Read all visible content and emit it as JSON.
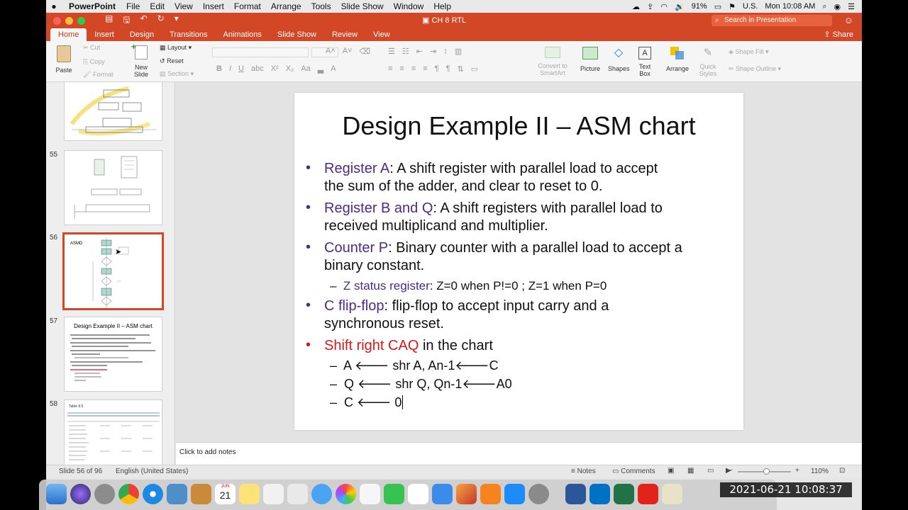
{
  "menubar": {
    "app": "PowerPoint",
    "items": [
      "File",
      "Edit",
      "View",
      "Insert",
      "Format",
      "Arrange",
      "Tools",
      "Slide Show",
      "Window",
      "Help"
    ],
    "battery": "91%",
    "input_source": "U.S.",
    "clock": "Mon 10:08 AM"
  },
  "titlebar": {
    "doc_title": "CH 8 RTL",
    "search_placeholder": "Search in Presentation"
  },
  "ribbon_tabs": {
    "items": [
      "Home",
      "Insert",
      "Design",
      "Transitions",
      "Animations",
      "Slide Show",
      "Review",
      "View"
    ],
    "active": "Home",
    "share": "Share"
  },
  "ribbon": {
    "paste": "Paste",
    "cut": "Cut",
    "copy": "Copy",
    "format": "Format",
    "new_slide_line1": "New",
    "new_slide_line2": "Slide",
    "layout": "Layout",
    "reset": "Reset",
    "section": "Section",
    "convert_line1": "Convert to",
    "convert_line2": "SmartArt",
    "picture": "Picture",
    "shapes": "Shapes",
    "textbox_line1": "Text",
    "textbox_line2": "Box",
    "arrange": "Arrange",
    "quick_line1": "Quick",
    "quick_line2": "Styles",
    "shape_fill": "Shape Fill",
    "shape_outline": "Shape Outline"
  },
  "thumbnails": {
    "slides": [
      {
        "number": "",
        "kind": "diagram"
      },
      {
        "number": "55",
        "kind": "circuit"
      },
      {
        "number": "56",
        "kind": "asmd",
        "label": "ASMD"
      },
      {
        "number": "57",
        "kind": "text",
        "title": "Design Example II – ASM chart"
      },
      {
        "number": "58",
        "kind": "table",
        "title": "Table 8.5"
      }
    ],
    "selected": "56"
  },
  "slide": {
    "title": "Design Example II – ASM chart",
    "b1_name": "Register A",
    "b1_line1": ": A shift register with parallel load to accept",
    "b1_line2": "the sum of the adder, and clear to reset to 0.",
    "b2_name": "Register B and Q",
    "b2_line1": ": A shift registers with parallel load to",
    "b2_line2": "received multiplicand and multiplier.",
    "b3_name": "Counter P",
    "b3_line1": ": Binary counter with a parallel load to accept a",
    "b3_line2": "binary constant.",
    "s1_name": "Z status register",
    "s1_text": ": Z=0 when P!=0 ; Z=1 when P=0",
    "b4_name": "C flip-flop",
    "b4_line1": ": flip-flop to accept input carry and a",
    "b4_line2": "synchronous reset.",
    "b5_name": "Shift right CAQ",
    "b5_text": " in the chart",
    "s2": "A ",
    "s2b": " shr A, An-1",
    "s2c": "C",
    "s3": "Q ",
    "s3b": " shr Q, Qn-1",
    "s3c": "A0",
    "s4": "C ",
    "s4b": " 0",
    "arrow": "🡐"
  },
  "notes": {
    "placeholder": "Click to add notes"
  },
  "statusbar": {
    "slide_count": "Slide 56 of 96",
    "language": "English (United States)",
    "notes": "Notes",
    "comments": "Comments",
    "zoom": "110%"
  },
  "dock": {
    "calendar_month": "JUN",
    "calendar_day": "21"
  },
  "overlay": {
    "timestamp": "2021-06-21 10:08:37"
  },
  "colors": {
    "accent": "#d24726",
    "purple": "#4b2a8a",
    "red": "#d21a1a"
  }
}
